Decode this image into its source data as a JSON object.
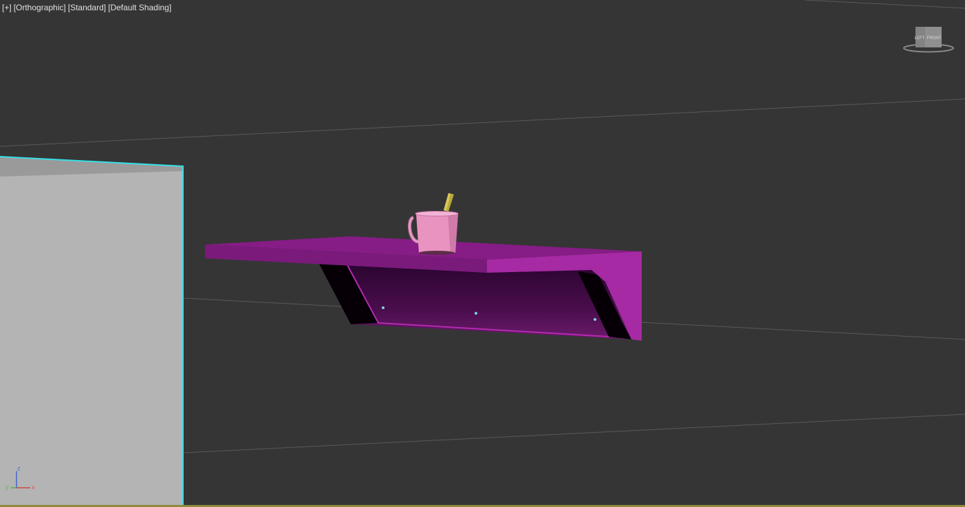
{
  "viewport": {
    "menu": {
      "plus": "[+]",
      "view": "[Orthographic]",
      "mode": "[Standard]",
      "shading": "[Default Shading]"
    },
    "viewcube": {
      "left_label": "LEFT",
      "front_label": "FRONT"
    },
    "axis": {
      "x": "x",
      "y": "y",
      "z": "z"
    }
  },
  "colors": {
    "background": "#353535",
    "selection": "#35e0e8",
    "shelf": "#a4209f",
    "mug": "#e893c0",
    "pencil": "#b8a83a",
    "wall_object": "#b4b4b4",
    "axis_x": "#d03030",
    "axis_y": "#30b030",
    "axis_z": "#3050d0"
  }
}
